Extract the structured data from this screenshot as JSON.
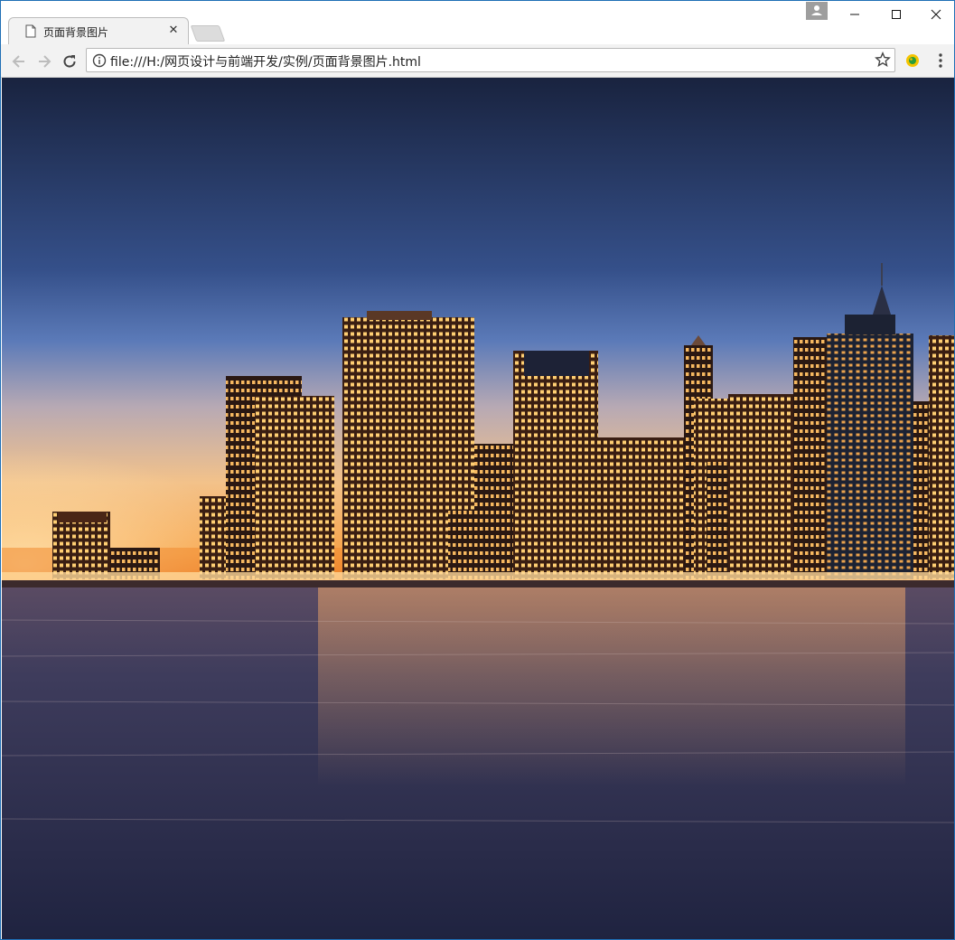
{
  "window": {
    "tab": {
      "title": "页面背景图片",
      "icon": "page-icon"
    },
    "controls": {
      "minimize_icon": "minimize-icon",
      "maximize_icon": "maximize-icon",
      "close_icon": "close-icon"
    }
  },
  "toolbar": {
    "url": "file:///H:/网页设计与前端开发/实例/页面背景图片.html",
    "icons": [
      "back-icon",
      "forward-icon",
      "reload-icon",
      "info-icon",
      "star-icon",
      "extension-icon",
      "menu-icon"
    ]
  },
  "page": {
    "background": "city-skyline-night-waterfront-photo",
    "colors": {
      "sky_top": "#1a2545",
      "sky_mid": "#3e5e93",
      "horizon": "#f7a34a",
      "water": "#2f3152"
    }
  }
}
